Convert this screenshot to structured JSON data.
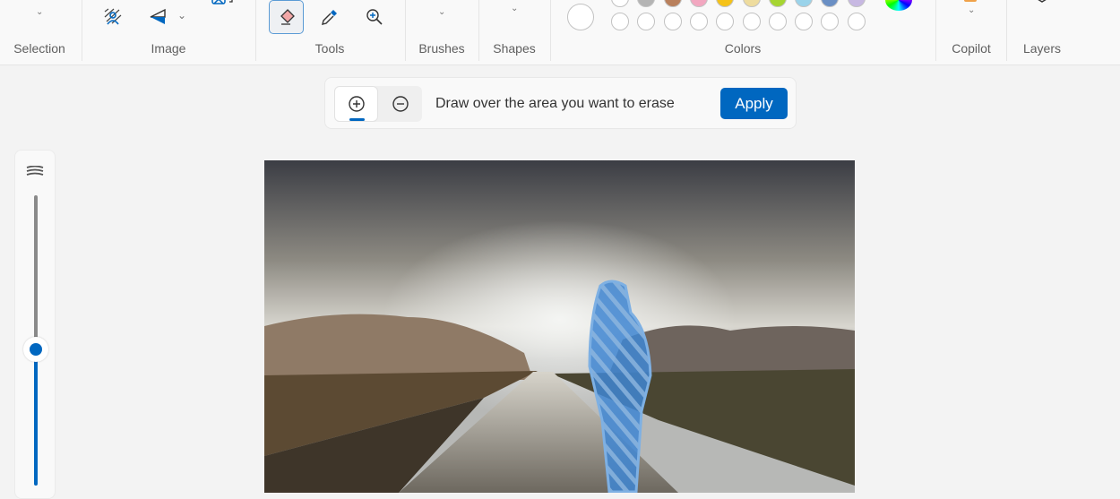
{
  "ribbon": {
    "groups": [
      {
        "label": "Selection"
      },
      {
        "label": "Image"
      },
      {
        "label": "Tools"
      },
      {
        "label": "Brushes"
      },
      {
        "label": "Shapes"
      },
      {
        "label": "Colors"
      },
      {
        "label": "Copilot"
      },
      {
        "label": "Layers"
      }
    ],
    "active_tool": "eraser",
    "colors_top_row": [
      "#ffffff",
      "#b4b4b4",
      "#b9805c",
      "#f2a7c0",
      "#f5c218",
      "#eedc9e",
      "#a6d531",
      "#9ad3ea",
      "#6a8fc4",
      "#c7b8e2"
    ],
    "primary_color": "#ffffff"
  },
  "erase_bar": {
    "add_mode_active": true,
    "hint": "Draw over the area you want to erase",
    "apply_label": "Apply"
  },
  "brush_size_slider": {
    "value_fraction": 0.47
  },
  "colors": {
    "accent": "#0067c0"
  }
}
